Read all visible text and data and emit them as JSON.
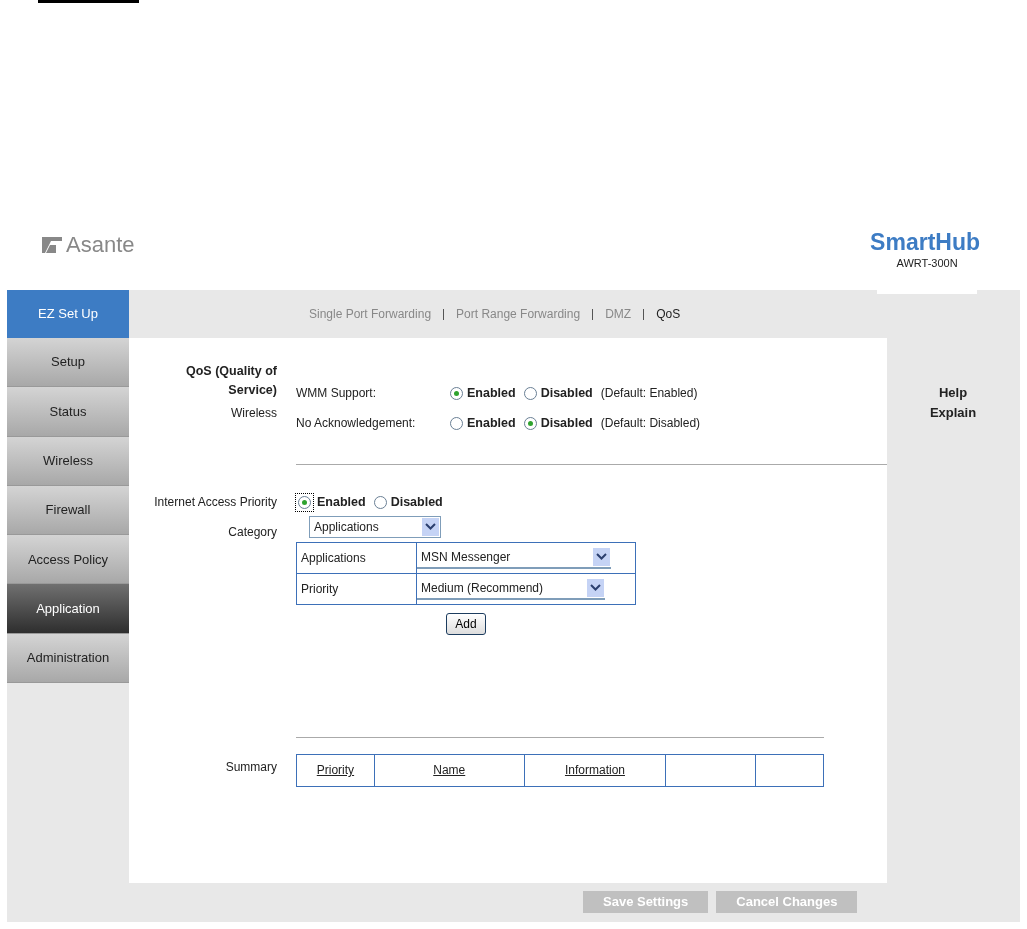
{
  "header": {
    "logo": "Asante",
    "product": "SmartHub",
    "model": "AWRT-300N"
  },
  "ez_setup_button": "EZ Set Up",
  "sidebar": {
    "items": [
      {
        "label": "Setup",
        "selected": false
      },
      {
        "label": "Status",
        "selected": false
      },
      {
        "label": "Wireless",
        "selected": false
      },
      {
        "label": "Firewall",
        "selected": false
      },
      {
        "label": "Access Policy",
        "selected": false
      },
      {
        "label": "Application",
        "selected": true
      },
      {
        "label": "Administration",
        "selected": false
      }
    ]
  },
  "subnav": [
    {
      "label": "Single Port Forwarding",
      "selected": false
    },
    {
      "label": "Port Range Forwarding",
      "selected": false
    },
    {
      "label": "DMZ",
      "selected": false
    },
    {
      "label": "QoS",
      "selected": true
    }
  ],
  "qos": {
    "title": "QoS (Quality of Service)",
    "subtitle": "Wireless",
    "settings": [
      {
        "label": "WMM Support:",
        "options": [
          {
            "label": "Enabled",
            "selected": true
          },
          {
            "label": "Disabled",
            "selected": false
          }
        ],
        "default": "(Default: Enabled)"
      },
      {
        "label": "No Acknowledgement:",
        "options": [
          {
            "label": "Enabled",
            "selected": false
          },
          {
            "label": "Disabled",
            "selected": true
          }
        ],
        "default": "(Default: Disabled)"
      }
    ]
  },
  "internet_access_priority": {
    "label": "Internet Access Priority",
    "options": [
      {
        "label": "Enabled",
        "selected": true
      },
      {
        "label": "Disabled",
        "selected": false
      }
    ],
    "category_label": "Category",
    "category": "Applications",
    "rows": [
      {
        "label": "Applications",
        "value": "MSN Messenger"
      },
      {
        "label": "Priority",
        "value": "Medium (Recommend)"
      }
    ],
    "add_button": "Add"
  },
  "summary": {
    "label": "Summary",
    "columns": [
      "Priority",
      "Name",
      "Information",
      "",
      ""
    ]
  },
  "help": {
    "title": "Help",
    "link": "Explain"
  },
  "buttons": [
    {
      "label": "Save Settings",
      "disabled": true
    },
    {
      "label": "Cancel Changes",
      "disabled": true
    }
  ]
}
